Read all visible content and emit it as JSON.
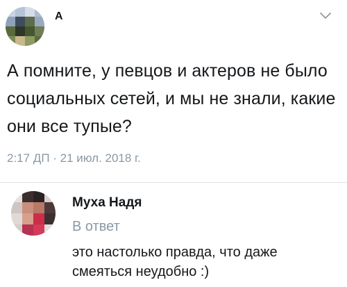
{
  "tweet": {
    "author_name": "А",
    "text": "А помните, у певцов и актеров не было социальных сетей, и мы не знали, какие они все тупые?",
    "timestamp": "2:17 ДП · 21 июл. 2018 г.",
    "menu_icon": "chevron-down-icon"
  },
  "reply": {
    "author_name": "Муха Надя",
    "label": "В ответ",
    "text": "это настолько правда, что даже смеяться неудобно :)"
  },
  "colors": {
    "text": "#14171a",
    "secondary": "#8b98a5",
    "divider": "#dfe3e8"
  }
}
